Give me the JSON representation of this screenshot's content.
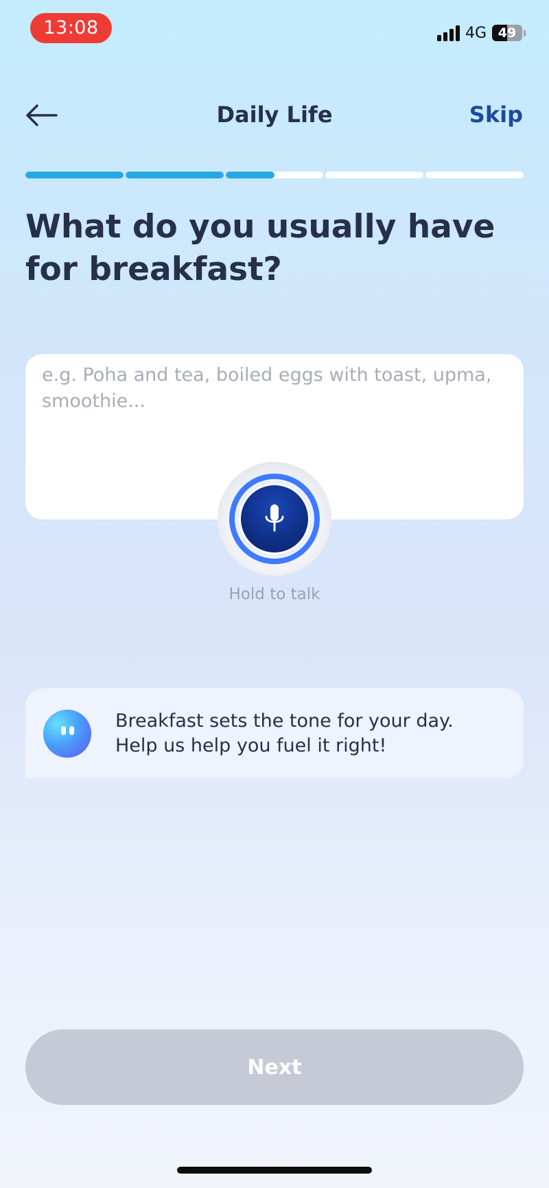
{
  "status_bar": {
    "time": "13:08",
    "network": "4G",
    "battery": "49",
    "battery_level": 0.49,
    "time_pill_color": "#ef3b36"
  },
  "header": {
    "back_icon": "arrow-left-icon",
    "title": "Daily Life",
    "skip_label": "Skip"
  },
  "progress": {
    "segments": 5,
    "completed_fraction": 0.5,
    "fill_color": "#27a8e4"
  },
  "question": "What do you usually have for breakfast?",
  "answer": {
    "value": "",
    "placeholder": "e.g. Poha and tea, boiled eggs with toast, upma, smoothie..."
  },
  "mic": {
    "icon": "microphone-icon",
    "label": "Hold to talk"
  },
  "tip": {
    "avatar_icon": "assistant-avatar-icon",
    "line1": "Breakfast sets the tone for your day.",
    "line2": "Help us help you fuel it right!"
  },
  "footer": {
    "next_label": "Next",
    "next_enabled": false
  },
  "colors": {
    "accent": "#1f4a9c",
    "title_text": "#26304a",
    "button_disabled": "#c6c9d6"
  }
}
